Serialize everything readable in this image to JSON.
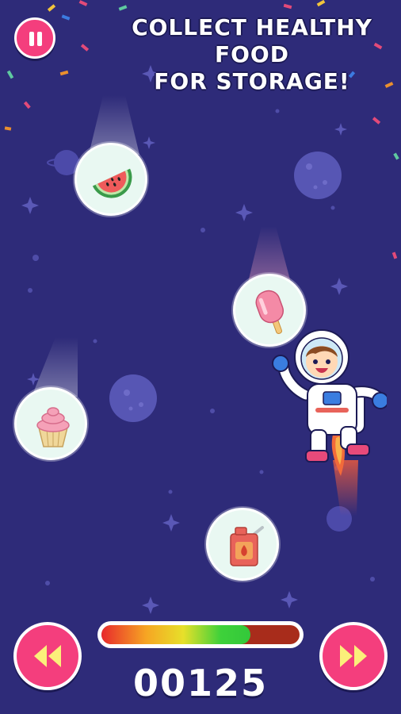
{
  "hud": {
    "title_line1": "COLLECT HEALTHY FOOD",
    "title_line2": "FOR STORAGE!",
    "score": "00125",
    "progress": 0.75
  },
  "items": [
    {
      "name": "watermelon",
      "icon": "watermelon-icon"
    },
    {
      "name": "popsicle",
      "icon": "popsicle-icon"
    },
    {
      "name": "cupcake",
      "icon": "cupcake-icon"
    },
    {
      "name": "fuel-can",
      "icon": "fuel-can-icon"
    }
  ],
  "colors": {
    "background": "#2e2b79",
    "button": "#f43e7d",
    "item_bg": "#e9f8f2",
    "bar_empty": "#a82c1b",
    "bar_full": "#33c83a"
  },
  "controls": {
    "pause_icon": "pause-icon",
    "left_icon": "rewind-icon",
    "right_icon": "fast-forward-icon"
  }
}
